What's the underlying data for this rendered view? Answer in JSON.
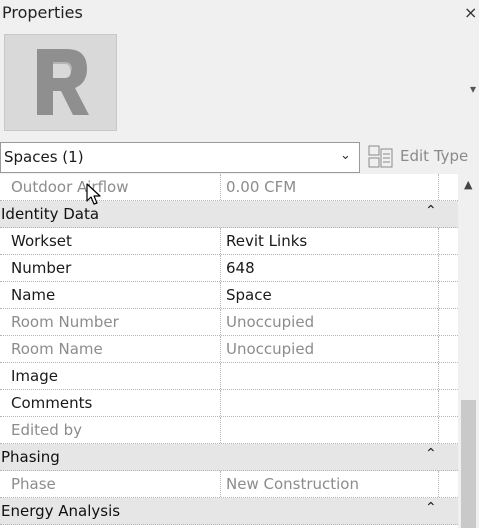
{
  "panel": {
    "title": "Properties",
    "close_icon": "close-icon"
  },
  "type_selector": {
    "value": "Spaces (1)",
    "edit_type_label": "Edit Type"
  },
  "groups": {
    "identity": "Identity Data",
    "phasing": "Phasing",
    "energy": "Energy Analysis"
  },
  "rows": {
    "outdoor_airflow": {
      "label": "Outdoor Airflow",
      "value": "0.00 CFM"
    },
    "workset": {
      "label": "Workset",
      "value": "Revit Links"
    },
    "number": {
      "label": "Number",
      "value": "648"
    },
    "name": {
      "label": "Name",
      "value": "Space"
    },
    "room_number": {
      "label": "Room Number",
      "value": "Unoccupied"
    },
    "room_name": {
      "label": "Room Name",
      "value": "Unoccupied"
    },
    "image": {
      "label": "Image",
      "value": ""
    },
    "comments": {
      "label": "Comments",
      "value": ""
    },
    "edited_by": {
      "label": "Edited by",
      "value": ""
    },
    "phase": {
      "label": "Phase",
      "value": "New Construction"
    }
  },
  "colors": {
    "group_bg": "#e6e6e6",
    "readonly_text": "#8c8c8c",
    "panel_bg": "#f0f0f0"
  }
}
